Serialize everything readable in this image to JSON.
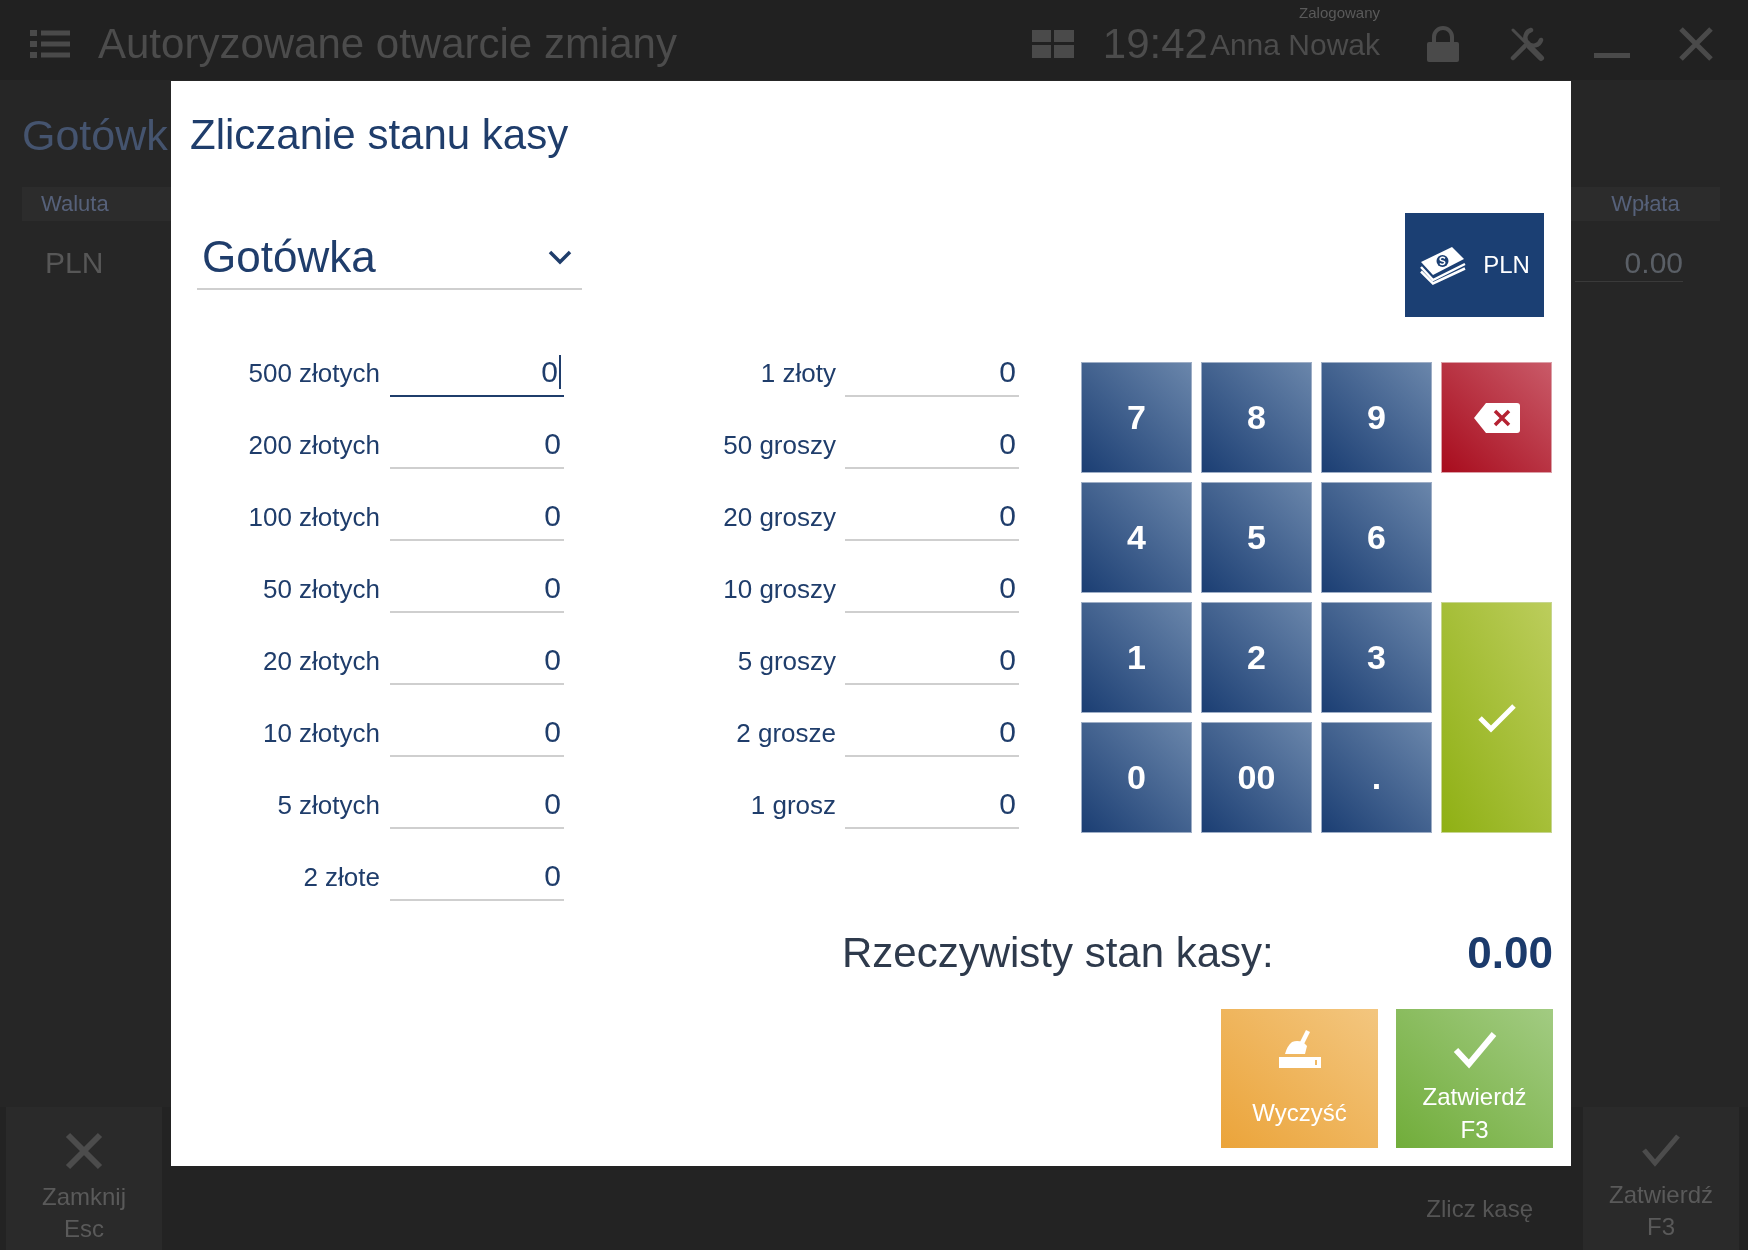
{
  "app_bar": {
    "title": "Autoryzowane otwarcie zmiany",
    "time": "19:42",
    "user_caption": "Zalogowany",
    "user_name": "Anna Nowak"
  },
  "page": {
    "heading": "Gotówk",
    "table": {
      "columns": [
        "Waluta",
        "Wpłata"
      ],
      "rows": [
        {
          "cells": [
            "PLN",
            "0.00"
          ]
        }
      ]
    }
  },
  "dialog": {
    "title": "Zliczanie stanu kasy",
    "payment_form": {
      "value": "Gotówka"
    },
    "currency_button": {
      "label": "PLN"
    },
    "denomination_columns": [
      {
        "items": [
          {
            "label": "500 złotych",
            "value": "0",
            "focused": true
          },
          {
            "label": "200 złotych",
            "value": "0",
            "focused": false
          },
          {
            "label": "100 złotych",
            "value": "0",
            "focused": false
          },
          {
            "label": "50 złotych",
            "value": "0",
            "focused": false
          },
          {
            "label": "20 złotych",
            "value": "0",
            "focused": false
          },
          {
            "label": "10 złotych",
            "value": "0",
            "focused": false
          },
          {
            "label": "5 złotych",
            "value": "0",
            "focused": false
          },
          {
            "label": "2 złote",
            "value": "0",
            "focused": false
          }
        ]
      },
      {
        "items": [
          {
            "label": "1 złoty",
            "value": "0",
            "focused": false
          },
          {
            "label": "50 groszy",
            "value": "0",
            "focused": false
          },
          {
            "label": "20 groszy",
            "value": "0",
            "focused": false
          },
          {
            "label": "10 groszy",
            "value": "0",
            "focused": false
          },
          {
            "label": "5 groszy",
            "value": "0",
            "focused": false
          },
          {
            "label": "2 grosze",
            "value": "0",
            "focused": false
          },
          {
            "label": "1 grosz",
            "value": "0",
            "focused": false
          }
        ]
      }
    ],
    "keypad": [
      {
        "kind": "digit",
        "label": "7"
      },
      {
        "kind": "digit",
        "label": "8"
      },
      {
        "kind": "digit",
        "label": "9"
      },
      {
        "kind": "backspace"
      },
      {
        "kind": "digit",
        "label": "4"
      },
      {
        "kind": "digit",
        "label": "5"
      },
      {
        "kind": "digit",
        "label": "6"
      },
      {
        "kind": "digit",
        "label": "1"
      },
      {
        "kind": "digit",
        "label": "2"
      },
      {
        "kind": "digit",
        "label": "3"
      },
      {
        "kind": "enter"
      },
      {
        "kind": "digit",
        "label": "0"
      },
      {
        "kind": "digit",
        "label": "00"
      },
      {
        "kind": "digit",
        "label": "."
      }
    ],
    "total": {
      "label": "Rzeczywisty stan kasy:",
      "value": "0.00"
    },
    "actions": [
      {
        "kind": "clear",
        "label": "Wyczyść"
      },
      {
        "kind": "confirm",
        "label": "Zatwierdź",
        "shortcut": "F3"
      }
    ]
  },
  "bottom_bar": {
    "buttons": [
      {
        "kind": "close",
        "label": "Zamknij",
        "shortcut": "Esc"
      },
      {
        "kind": "plain",
        "label": "Zlicz kasę"
      },
      {
        "kind": "confirm",
        "label": "Zatwierdź",
        "shortcut": "F3"
      }
    ]
  }
}
